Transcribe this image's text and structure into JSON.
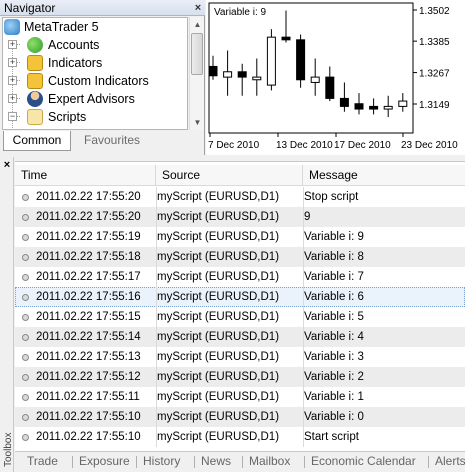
{
  "navigator": {
    "title": "Navigator",
    "close_glyph": "×",
    "tree": [
      {
        "label": "MetaTrader 5",
        "icon": "metatrader-logo-icon"
      },
      {
        "label": "Accounts",
        "icon": "accounts-icon"
      },
      {
        "label": "Indicators",
        "icon": "indicators-icon"
      },
      {
        "label": "Custom Indicators",
        "icon": "custom-indicators-icon"
      },
      {
        "label": "Expert Advisors",
        "icon": "expert-advisors-icon"
      },
      {
        "label": "Scripts",
        "icon": "scripts-icon"
      }
    ],
    "tabs": {
      "common": "Common",
      "favourites": "Favourites"
    }
  },
  "chart": {
    "annotation": "Variable i: 9",
    "price_labels": [
      "1.3502",
      "1.3385",
      "1.3267",
      "1.3149"
    ],
    "date_labels": [
      "7 Dec 2010",
      "13 Dec 2010",
      "17 Dec 2010",
      "23 Dec 2010"
    ],
    "colors": {
      "bg": "#ffffff",
      "candle": "#000000"
    }
  },
  "chart_data": {
    "type": "candlestick",
    "y_ticks": [
      1.3502,
      1.3385,
      1.3267,
      1.3149
    ],
    "x_ticks": [
      "7 Dec 2010",
      "13 Dec 2010",
      "17 Dec 2010",
      "23 Dec 2010"
    ],
    "candles": [
      {
        "o": 1.329,
        "h": 1.333,
        "l": 1.324,
        "c": 1.3255,
        "bull": false
      },
      {
        "o": 1.325,
        "h": 1.335,
        "l": 1.318,
        "c": 1.327,
        "bull": true
      },
      {
        "o": 1.327,
        "h": 1.33,
        "l": 1.318,
        "c": 1.325,
        "bull": false
      },
      {
        "o": 1.324,
        "h": 1.332,
        "l": 1.318,
        "c": 1.325,
        "bull": true
      },
      {
        "o": 1.322,
        "h": 1.343,
        "l": 1.32,
        "c": 1.34,
        "bull": true
      },
      {
        "o": 1.34,
        "h": 1.35,
        "l": 1.338,
        "c": 1.339,
        "bull": false
      },
      {
        "o": 1.339,
        "h": 1.341,
        "l": 1.321,
        "c": 1.324,
        "bull": false
      },
      {
        "o": 1.325,
        "h": 1.332,
        "l": 1.318,
        "c": 1.323,
        "bull": true
      },
      {
        "o": 1.325,
        "h": 1.329,
        "l": 1.316,
        "c": 1.317,
        "bull": false
      },
      {
        "o": 1.317,
        "h": 1.323,
        "l": 1.312,
        "c": 1.314,
        "bull": false
      },
      {
        "o": 1.315,
        "h": 1.319,
        "l": 1.311,
        "c": 1.313,
        "bull": false
      },
      {
        "o": 1.314,
        "h": 1.317,
        "l": 1.311,
        "c": 1.313,
        "bull": false
      },
      {
        "o": 1.313,
        "h": 1.318,
        "l": 1.31,
        "c": 1.314,
        "bull": true
      },
      {
        "o": 1.314,
        "h": 1.319,
        "l": 1.312,
        "c": 1.316,
        "bull": true
      }
    ]
  },
  "toolbox": {
    "label": "Toolbox",
    "close_glyph": "×",
    "columns": {
      "time": "Time",
      "source": "Source",
      "message": "Message"
    },
    "rows": [
      {
        "time": "2011.02.22 17:55:20",
        "source": "myScript (EURUSD,D1)",
        "message": "Stop script"
      },
      {
        "time": "2011.02.22 17:55:20",
        "source": "myScript (EURUSD,D1)",
        "message": "9"
      },
      {
        "time": "2011.02.22 17:55:19",
        "source": "myScript (EURUSD,D1)",
        "message": "Variable i: 9"
      },
      {
        "time": "2011.02.22 17:55:18",
        "source": "myScript (EURUSD,D1)",
        "message": "Variable i: 8"
      },
      {
        "time": "2011.02.22 17:55:17",
        "source": "myScript (EURUSD,D1)",
        "message": "Variable i: 7"
      },
      {
        "time": "2011.02.22 17:55:16",
        "source": "myScript (EURUSD,D1)",
        "message": "Variable i: 6"
      },
      {
        "time": "2011.02.22 17:55:15",
        "source": "myScript (EURUSD,D1)",
        "message": "Variable i: 5"
      },
      {
        "time": "2011.02.22 17:55:14",
        "source": "myScript (EURUSD,D1)",
        "message": "Variable i: 4"
      },
      {
        "time": "2011.02.22 17:55:13",
        "source": "myScript (EURUSD,D1)",
        "message": "Variable i: 3"
      },
      {
        "time": "2011.02.22 17:55:12",
        "source": "myScript (EURUSD,D1)",
        "message": "Variable i: 2"
      },
      {
        "time": "2011.02.22 17:55:11",
        "source": "myScript (EURUSD,D1)",
        "message": "Variable i: 1"
      },
      {
        "time": "2011.02.22 17:55:10",
        "source": "myScript (EURUSD,D1)",
        "message": "Variable i: 0"
      },
      {
        "time": "2011.02.22 17:55:10",
        "source": "myScript (EURUSD,D1)",
        "message": "Start script"
      }
    ],
    "tabs": [
      "Trade",
      "Exposure",
      "History",
      "News",
      "Mailbox",
      "Economic Calendar",
      "Alerts"
    ]
  }
}
